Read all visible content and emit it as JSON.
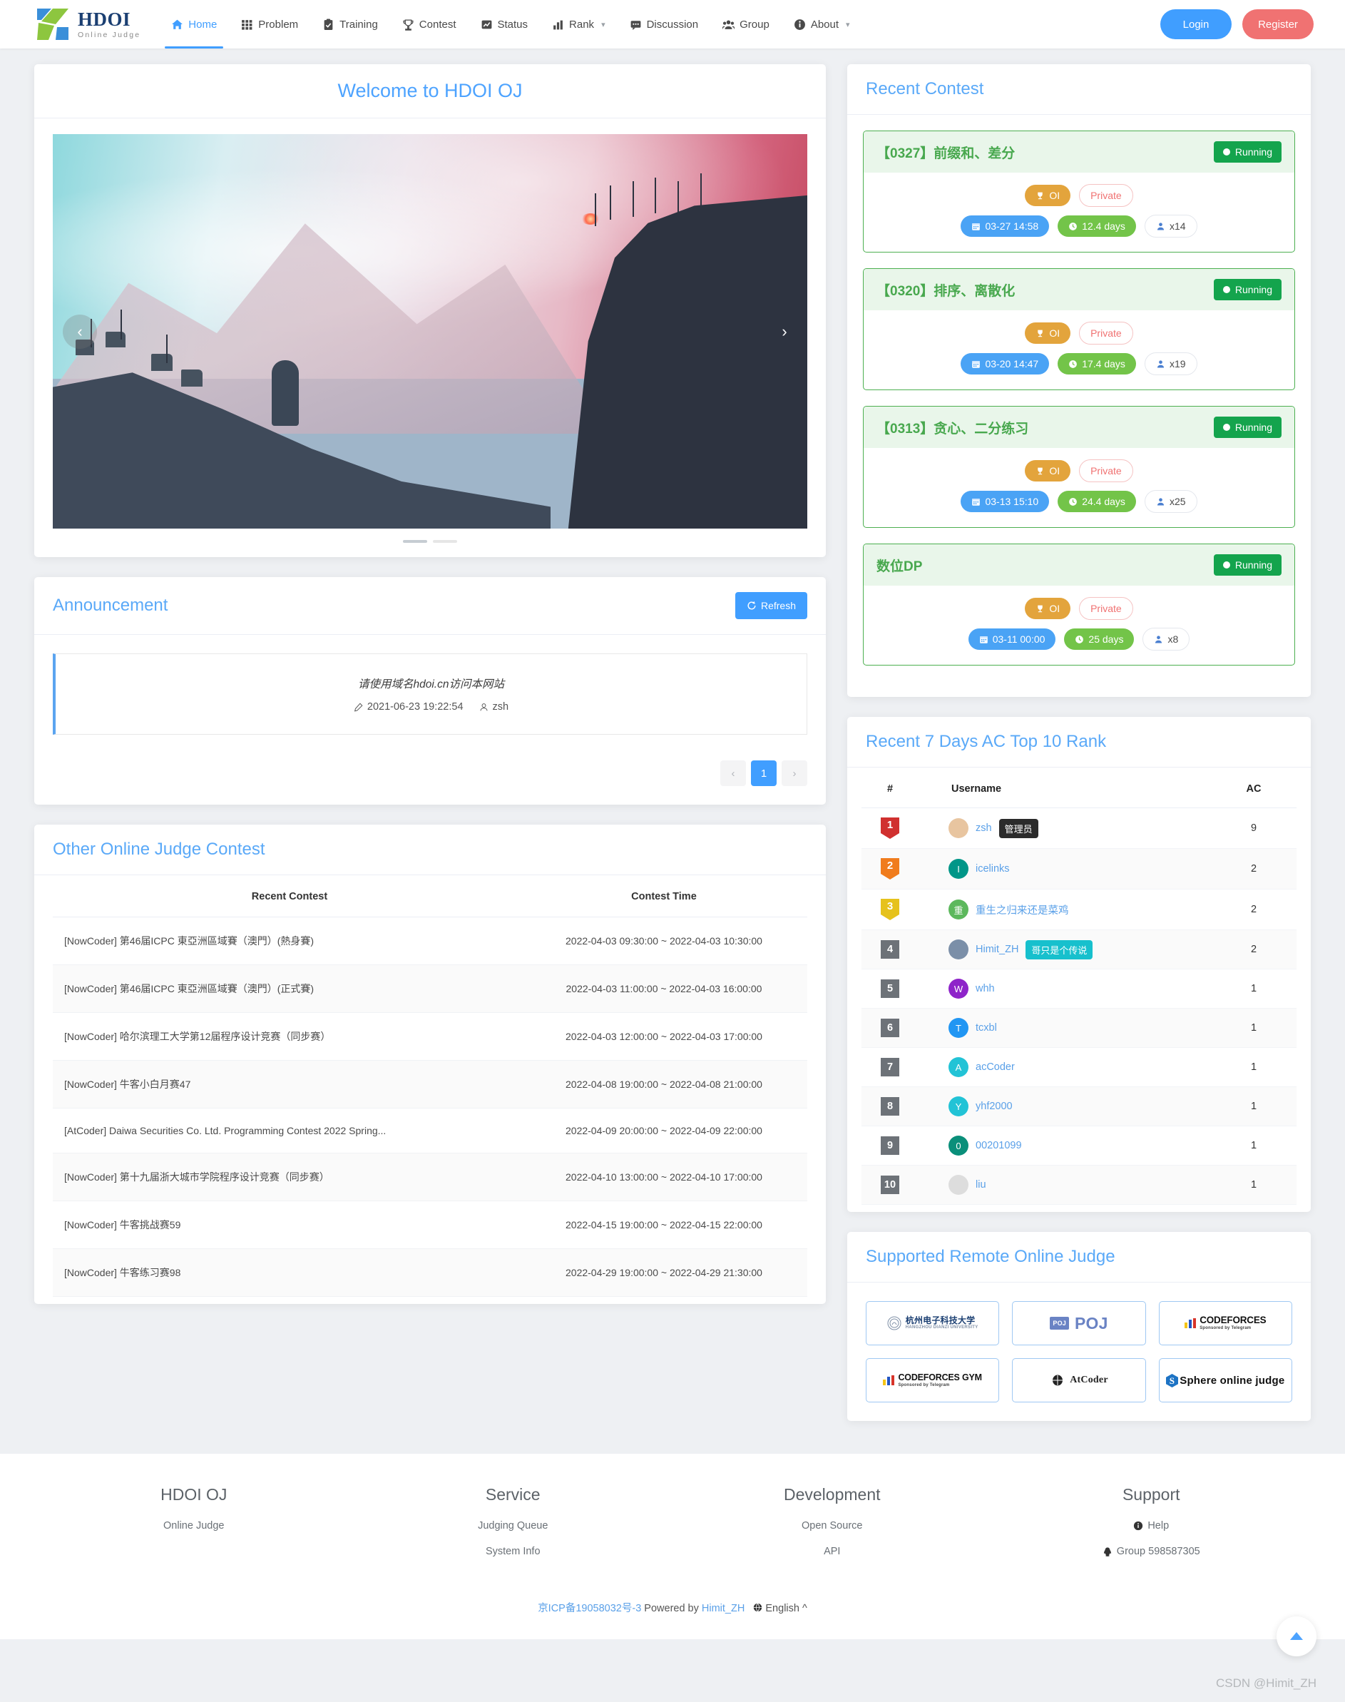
{
  "nav": {
    "brand": {
      "title": "HDOI",
      "subtitle": "Online Judge",
      "logo_icon": "hdoi-logo-icon"
    },
    "items": [
      {
        "label": "Home",
        "icon": "home-icon",
        "active": true,
        "caret": false
      },
      {
        "label": "Problem",
        "icon": "grid-icon",
        "active": false,
        "caret": false
      },
      {
        "label": "Training",
        "icon": "clipboard-check-icon",
        "active": false,
        "caret": false
      },
      {
        "label": "Contest",
        "icon": "trophy-icon",
        "active": false,
        "caret": false
      },
      {
        "label": "Status",
        "icon": "chart-line-icon",
        "active": false,
        "caret": false
      },
      {
        "label": "Rank",
        "icon": "bar-chart-icon",
        "active": false,
        "caret": true
      },
      {
        "label": "Discussion",
        "icon": "comment-icon",
        "active": false,
        "caret": false
      },
      {
        "label": "Group",
        "icon": "users-icon",
        "active": false,
        "caret": false
      },
      {
        "label": "About",
        "icon": "info-icon",
        "active": false,
        "caret": true
      }
    ],
    "login_label": "Login",
    "register_label": "Register",
    "login_color": "#409eff",
    "register_color": "#f07272"
  },
  "welcome": {
    "title": "Welcome to HDOI OJ",
    "carousel": {
      "prev_icon": "chevron-left-icon",
      "next_icon": "chevron-right-icon",
      "slides": 2,
      "active_slide": 1
    }
  },
  "announcement": {
    "title": "Announcement",
    "refresh_label": "Refresh",
    "refresh_icon": "refresh-icon",
    "items": [
      {
        "text": "请使用域名hdoi.cn访问本网站",
        "time": "2021-06-23 19:22:54",
        "author": "zsh",
        "time_icon": "pencil-icon",
        "author_icon": "user-icon"
      }
    ],
    "pager": {
      "prev": "‹",
      "pages": [
        "1"
      ],
      "next": "›",
      "current": "1"
    }
  },
  "other_oj": {
    "title": "Other Online Judge Contest",
    "columns": [
      "Recent Contest",
      "Contest Time"
    ],
    "rows": [
      {
        "name": "[NowCoder] 第46届ICPC 東亞洲區域賽（澳門）(熱身賽)",
        "time": "2022-04-03 09:30:00 ~ 2022-04-03 10:30:00"
      },
      {
        "name": "[NowCoder] 第46届ICPC 東亞洲區域賽（澳門）(正式賽)",
        "time": "2022-04-03 11:00:00 ~ 2022-04-03 16:00:00"
      },
      {
        "name": "[NowCoder] 哈尔滨理工大学第12届程序设计竞赛（同步赛）",
        "time": "2022-04-03 12:00:00 ~ 2022-04-03 17:00:00"
      },
      {
        "name": "[NowCoder] 牛客小白月赛47",
        "time": "2022-04-08 19:00:00 ~ 2022-04-08 21:00:00"
      },
      {
        "name": "[AtCoder] Daiwa Securities Co. Ltd. Programming Contest 2022 Spring...",
        "time": "2022-04-09 20:00:00 ~ 2022-04-09 22:00:00"
      },
      {
        "name": "[NowCoder] 第十九届浙大城市学院程序设计竞赛（同步赛）",
        "time": "2022-04-10 13:00:00 ~ 2022-04-10 17:00:00"
      },
      {
        "name": "[NowCoder] 牛客挑战赛59",
        "time": "2022-04-15 19:00:00 ~ 2022-04-15 22:00:00"
      },
      {
        "name": "[NowCoder] 牛客练习赛98",
        "time": "2022-04-29 19:00:00 ~ 2022-04-29 21:30:00"
      }
    ]
  },
  "recent_contest": {
    "title": "Recent Contest",
    "cards": [
      {
        "name": "【0327】前缀和、差分",
        "status": "Running",
        "type": "OI",
        "visibility": "Private",
        "start": "03-27 14:58",
        "duration": "12.4 days",
        "members": "x14"
      },
      {
        "name": "【0320】排序、离散化",
        "status": "Running",
        "type": "OI",
        "visibility": "Private",
        "start": "03-20 14:47",
        "duration": "17.4 days",
        "members": "x19"
      },
      {
        "name": "【0313】贪心、二分练习",
        "status": "Running",
        "type": "OI",
        "visibility": "Private",
        "start": "03-13 15:10",
        "duration": "24.4 days",
        "members": "x25"
      },
      {
        "name": "数位DP",
        "status": "Running",
        "type": "OI",
        "visibility": "Private",
        "start": "03-11 00:00",
        "duration": "25 days",
        "members": "x8"
      }
    ]
  },
  "rank": {
    "title": "Recent 7 Days AC Top 10 Rank",
    "columns": [
      "#",
      "Username",
      "AC"
    ],
    "rows": [
      {
        "rank": "1",
        "username": "zsh",
        "ac": "9",
        "badge": "管理员",
        "badge_color": "#2b2b2b",
        "avatar_color": "#e8c5a0",
        "avatar_letter": ""
      },
      {
        "rank": "2",
        "username": "icelinks",
        "ac": "2",
        "badge": "",
        "badge_color": "",
        "avatar_color": "#009688",
        "avatar_letter": "I"
      },
      {
        "rank": "3",
        "username": "重生之归来还是菜鸡",
        "ac": "2",
        "badge": "",
        "badge_color": "",
        "avatar_color": "#5cb85c",
        "avatar_letter": "重"
      },
      {
        "rank": "4",
        "username": "Himit_ZH",
        "ac": "2",
        "badge": "哥只是个传说",
        "badge_color": "#17c0cd",
        "avatar_color": "#7b8fa8",
        "avatar_letter": ""
      },
      {
        "rank": "5",
        "username": "whh",
        "ac": "1",
        "badge": "",
        "badge_color": "",
        "avatar_color": "#8e24c9",
        "avatar_letter": "W"
      },
      {
        "rank": "6",
        "username": "tcxbl",
        "ac": "1",
        "badge": "",
        "badge_color": "",
        "avatar_color": "#2196f3",
        "avatar_letter": "T"
      },
      {
        "rank": "7",
        "username": "acCoder",
        "ac": "1",
        "badge": "",
        "badge_color": "",
        "avatar_color": "#22c3d6",
        "avatar_letter": "A"
      },
      {
        "rank": "8",
        "username": "yhf2000",
        "ac": "1",
        "badge": "",
        "badge_color": "",
        "avatar_color": "#22c3d6",
        "avatar_letter": "Y"
      },
      {
        "rank": "9",
        "username": "00201099",
        "ac": "1",
        "badge": "",
        "badge_color": "",
        "avatar_color": "#0a8f7a",
        "avatar_letter": "0"
      },
      {
        "rank": "10",
        "username": "liu",
        "ac": "1",
        "badge": "",
        "badge_color": "",
        "avatar_color": "#dddddd",
        "avatar_letter": ""
      }
    ]
  },
  "remote_judge": {
    "title": "Supported Remote Online Judge",
    "items": [
      {
        "name": "HDU",
        "label": "杭州电子科技大学"
      },
      {
        "name": "POJ",
        "label": "POJ"
      },
      {
        "name": "CodeForces",
        "label": "CODEFORCES"
      },
      {
        "name": "CodeForcesGym",
        "label": "CODEFORCES GYM"
      },
      {
        "name": "AtCoder",
        "label": "AtCoder"
      },
      {
        "name": "SPOJ",
        "label": "Sphere online judge"
      }
    ]
  },
  "footer": {
    "columns": [
      {
        "title": "HDOI OJ",
        "links": [
          {
            "label": "Online Judge",
            "icon": ""
          }
        ]
      },
      {
        "title": "Service",
        "links": [
          {
            "label": "Judging Queue",
            "icon": ""
          },
          {
            "label": "System Info",
            "icon": ""
          }
        ]
      },
      {
        "title": "Development",
        "links": [
          {
            "label": "Open Source",
            "icon": ""
          },
          {
            "label": "API",
            "icon": ""
          }
        ]
      },
      {
        "title": "Support",
        "links": [
          {
            "label": "Help",
            "icon": "info-circle-icon"
          },
          {
            "label": "Group 598587305",
            "icon": "qq-icon"
          }
        ]
      }
    ],
    "icp": "京ICP备19058032号-3",
    "powered_by": "Powered by",
    "author": "Himit_ZH",
    "language": "English",
    "language_icon": "globe-icon",
    "language_caret": "^",
    "watermark": "CSDN @Himit_ZH",
    "backtop_icon": "arrow-up-icon"
  }
}
